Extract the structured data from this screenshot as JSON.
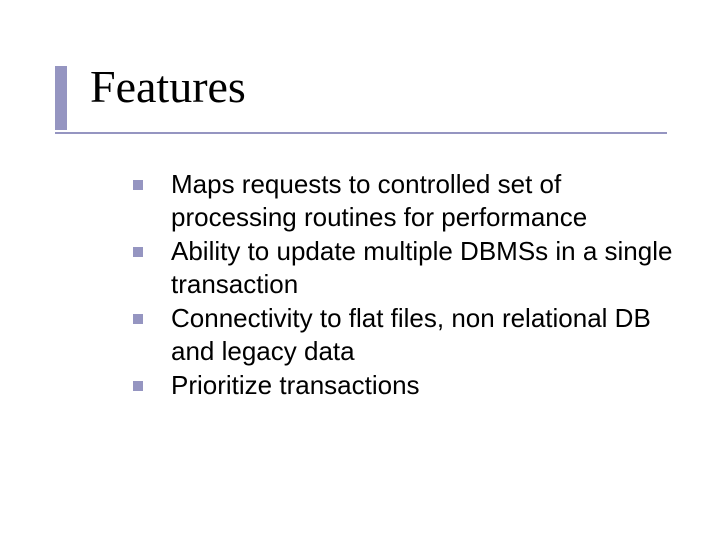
{
  "slide": {
    "title": "Features",
    "bullets": [
      "Maps requests to controlled set of processing routines for performance",
      "Ability to update multiple DBMSs in a single transaction",
      "Connectivity to flat files, non relational DB and legacy data",
      "Prioritize transactions"
    ]
  }
}
